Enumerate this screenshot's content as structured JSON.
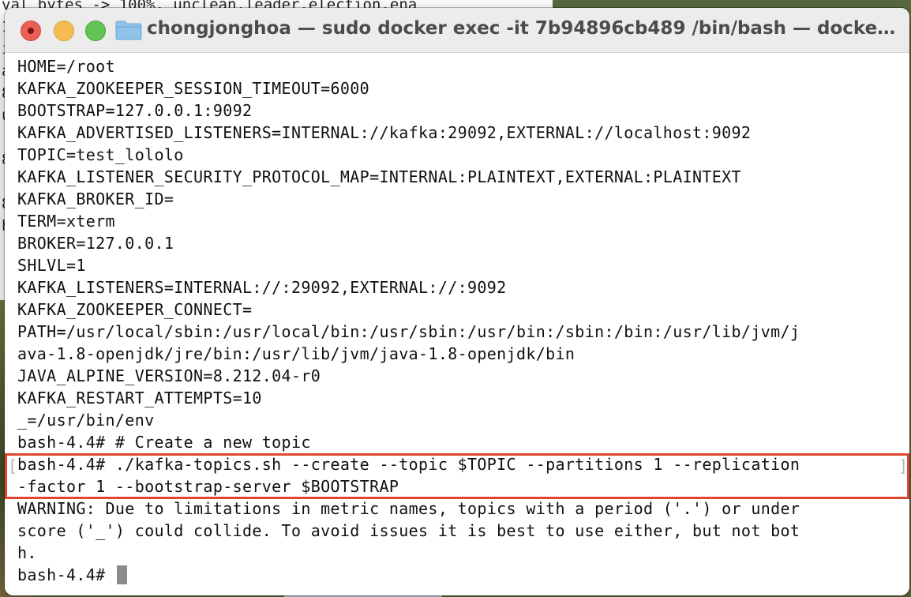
{
  "background": {
    "lines": [
      "val_bytes -> 100%, unclean.leader.election.ena",
      "1",
      "i",
      "a",
      "8",
      "u",
      "",
      "8",
      "",
      "8",
      "h"
    ]
  },
  "window": {
    "title": "chongjonghoa — sudo docker exec -it 7b94896cb489 /bin/bash — docker…",
    "folder_icon": "folder-icon"
  },
  "terminal": {
    "lines": [
      "HOME=/root",
      "KAFKA_ZOOKEEPER_SESSION_TIMEOUT=6000",
      "BOOTSTRAP=127.0.0.1:9092",
      "KAFKA_ADVERTISED_LISTENERS=INTERNAL://kafka:29092,EXTERNAL://localhost:9092",
      "TOPIC=test_lololo",
      "KAFKA_LISTENER_SECURITY_PROTOCOL_MAP=INTERNAL:PLAINTEXT,EXTERNAL:PLAINTEXT",
      "KAFKA_BROKER_ID=",
      "TERM=xterm",
      "BROKER=127.0.0.1",
      "SHLVL=1",
      "KAFKA_LISTENERS=INTERNAL://:29092,EXTERNAL://:9092",
      "KAFKA_ZOOKEEPER_CONNECT=",
      "PATH=/usr/local/sbin:/usr/local/bin:/usr/sbin:/usr/bin:/sbin:/bin:/usr/lib/jvm/j",
      "ava-1.8-openjdk/jre/bin:/usr/lib/jvm/java-1.8-openjdk/bin",
      "JAVA_ALPINE_VERSION=8.212.04-r0",
      "KAFKA_RESTART_ATTEMPTS=10",
      "_=/usr/bin/env",
      "bash-4.4# # Create a new topic",
      "bash-4.4# ./kafka-topics.sh --create --topic $TOPIC --partitions 1 --replication",
      "-factor 1 --bootstrap-server $BOOTSTRAP",
      "WARNING: Due to limitations in metric names, topics with a period ('.') or under",
      "score ('_') could collide. To avoid issues it is best to use either, but not bot",
      "h."
    ],
    "prompt": "bash-4.4# ",
    "highlight_color": "#e0452f"
  }
}
